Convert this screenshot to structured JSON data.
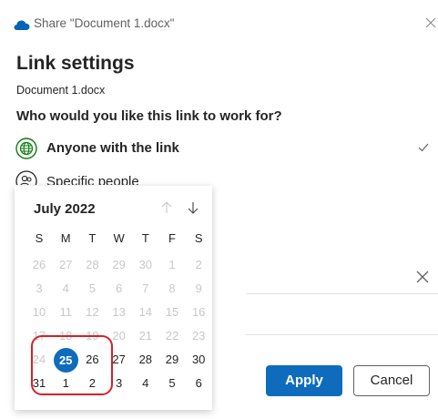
{
  "window": {
    "title": "Share \"Document 1.docx\""
  },
  "header": {
    "title": "Link settings",
    "document": "Document 1.docx",
    "question": "Who would you like this link to work for?"
  },
  "options": [
    {
      "label": "Anyone with the link",
      "selected": true
    },
    {
      "label": "Specific people",
      "selected": false
    }
  ],
  "buttons": {
    "apply": "Apply",
    "cancel": "Cancel"
  },
  "calendar": {
    "month_label": "July 2022",
    "weekdays": [
      "S",
      "M",
      "T",
      "W",
      "T",
      "F",
      "S"
    ],
    "selected_day": "25",
    "weeks": [
      [
        {
          "d": "26",
          "m": true
        },
        {
          "d": "27",
          "m": true
        },
        {
          "d": "28",
          "m": true
        },
        {
          "d": "29",
          "m": true
        },
        {
          "d": "30",
          "m": true
        },
        {
          "d": "1",
          "m": true
        },
        {
          "d": "2",
          "m": true
        }
      ],
      [
        {
          "d": "3",
          "m": true
        },
        {
          "d": "4",
          "m": true
        },
        {
          "d": "5",
          "m": true
        },
        {
          "d": "6",
          "m": true
        },
        {
          "d": "7",
          "m": true
        },
        {
          "d": "8",
          "m": true
        },
        {
          "d": "9",
          "m": true
        }
      ],
      [
        {
          "d": "10",
          "m": true
        },
        {
          "d": "11",
          "m": true
        },
        {
          "d": "12",
          "m": true
        },
        {
          "d": "13",
          "m": true
        },
        {
          "d": "14",
          "m": true
        },
        {
          "d": "15",
          "m": true
        },
        {
          "d": "16",
          "m": true
        }
      ],
      [
        {
          "d": "17",
          "m": true
        },
        {
          "d": "18",
          "m": true
        },
        {
          "d": "19",
          "m": true
        },
        {
          "d": "20",
          "m": true
        },
        {
          "d": "21",
          "m": true
        },
        {
          "d": "22",
          "m": true
        },
        {
          "d": "23",
          "m": true
        }
      ],
      [
        {
          "d": "24",
          "m": true
        },
        {
          "d": "25",
          "m": false
        },
        {
          "d": "26",
          "m": false
        },
        {
          "d": "27",
          "m": false
        },
        {
          "d": "28",
          "m": false
        },
        {
          "d": "29",
          "m": false
        },
        {
          "d": "30",
          "m": false
        }
      ],
      [
        {
          "d": "31",
          "m": false
        },
        {
          "d": "1",
          "m": false
        },
        {
          "d": "2",
          "m": false
        },
        {
          "d": "3",
          "m": false
        },
        {
          "d": "4",
          "m": false
        },
        {
          "d": "5",
          "m": false
        },
        {
          "d": "6",
          "m": false
        }
      ]
    ]
  },
  "colors": {
    "accent": "#0f6cbd",
    "annotation": "#d42128",
    "onedrive": "#0364b8"
  }
}
